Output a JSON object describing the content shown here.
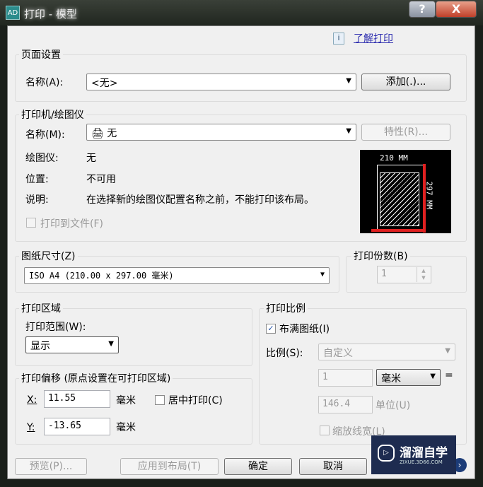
{
  "window": {
    "title": "打印 - 模型",
    "help": "?",
    "close": "X"
  },
  "learn_link": "了解打印",
  "page_setup": {
    "label": "页面设置",
    "name_label": "名称(A):",
    "name_value": "<无>",
    "add_button": "添加(.)..."
  },
  "plotter": {
    "label": "打印机/绘图仪",
    "name_label": "名称(M):",
    "name_value": "无",
    "properties_button": "特性(R)...",
    "plotter_label": "绘图仪:",
    "plotter_value": "无",
    "location_label": "位置:",
    "location_value": "不可用",
    "desc_label": "说明:",
    "desc_value": "在选择新的绘图仪配置名称之前，不能打印该布局。",
    "print_to_file": "打印到文件(F)",
    "preview_width": "210 MM",
    "preview_height": "297 MM"
  },
  "paper": {
    "label": "图纸尺寸(Z)",
    "value": "ISO A4 (210.00 x 297.00 毫米)"
  },
  "copies": {
    "label": "打印份数(B)",
    "value": "1"
  },
  "area": {
    "label": "打印区域",
    "range_label": "打印范围(W):",
    "range_value": "显示"
  },
  "offset": {
    "label": "打印偏移 (原点设置在可打印区域)",
    "x_label": "X:",
    "x_value": "11.55",
    "y_label": "Y:",
    "y_value": "-13.65",
    "unit": "毫米",
    "center": "居中打印(C)"
  },
  "scale": {
    "label": "打印比例",
    "fit": "布满图纸(I)",
    "fit_checked": true,
    "scale_label": "比例(S):",
    "scale_value": "自定义",
    "num": "1",
    "unit": "毫米",
    "equals": "=",
    "units_value": "146.4",
    "units_label": "单位(U)",
    "lineweights": "缩放线宽(L)"
  },
  "buttons": {
    "preview": "预览(P)...",
    "apply": "应用到布局(T)",
    "ok": "确定",
    "cancel": "取消"
  },
  "watermark": {
    "name": "溜溜自学",
    "url": "ZIXUE.3D66.COM"
  }
}
